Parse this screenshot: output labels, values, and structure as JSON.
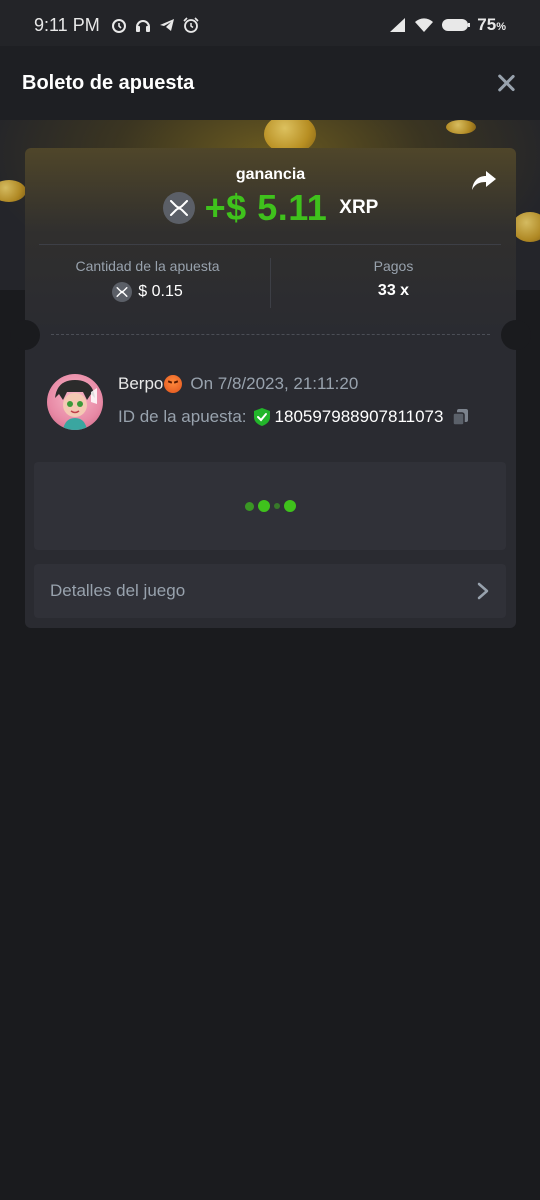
{
  "status_bar": {
    "time": "9:11 PM",
    "battery_percent": "75",
    "battery_suffix": "%",
    "icons": [
      "alarm-icon",
      "headset-icon",
      "telegram-icon",
      "alarm-clock-icon",
      "signal-icon",
      "wifi-icon",
      "battery-icon"
    ]
  },
  "header": {
    "title": "Boleto de apuesta",
    "close_icon": "close-icon"
  },
  "win": {
    "label": "ganancia",
    "amount": "+$ 5.11",
    "currency": "XRP",
    "amount_color": "#3fc21c"
  },
  "stats": {
    "bet_amount_label": "Cantidad de la apuesta",
    "bet_amount_value": "$ 0.15",
    "payout_label": "Pagos",
    "payout_value": "33 x"
  },
  "user": {
    "name": "Berpo",
    "date": "On 7/8/2023, 21:11:20",
    "bet_id_label": "ID de la apuesta:",
    "bet_id": "180597988907811073"
  },
  "details": {
    "label": "Detalles del juego"
  },
  "colors": {
    "background": "#1a1b1e",
    "card": "#2a2b31",
    "accent_green": "#3fc21c",
    "muted_text": "#98a2ad"
  }
}
